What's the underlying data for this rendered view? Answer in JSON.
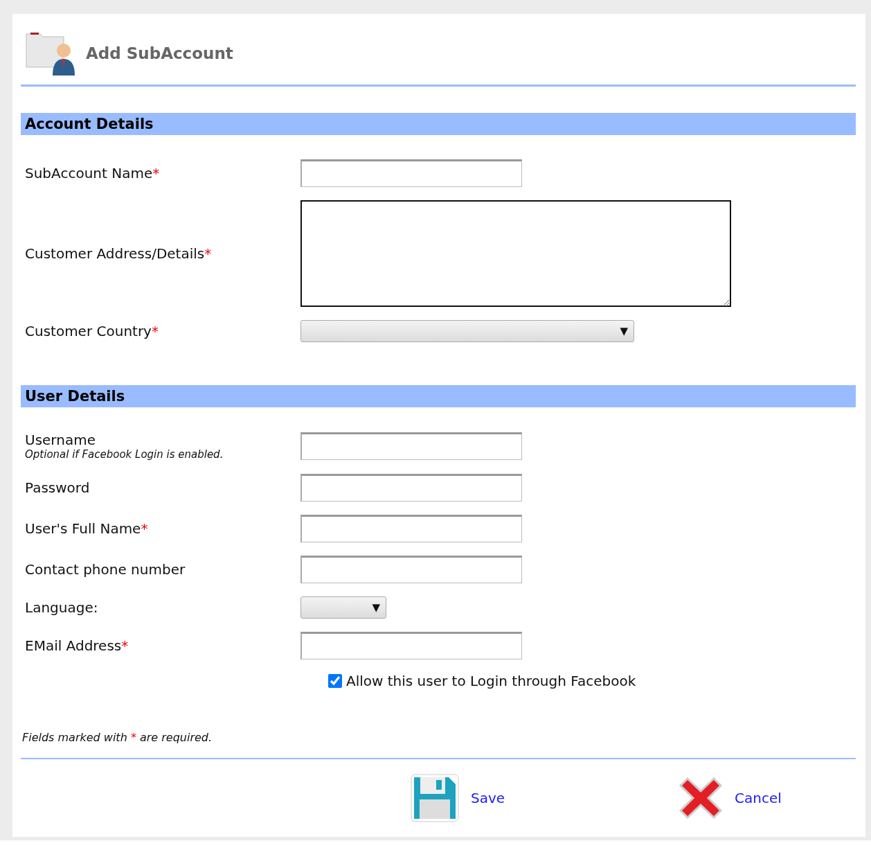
{
  "header": {
    "title": "Add SubAccount"
  },
  "sections": [
    {
      "title": "Account Details",
      "fields": [
        {
          "kind": "text",
          "label": "SubAccount Name",
          "mark": "*"
        },
        {
          "kind": "textarea",
          "label": "Customer Address/Details",
          "mark": "*"
        },
        {
          "kind": "select-wide",
          "label": "Customer Country",
          "mark": "*",
          "arrow": "▼"
        }
      ]
    },
    {
      "title": "User Details",
      "fields": [
        {
          "kind": "text",
          "label": "Username",
          "hint": "Optional if Facebook Login is enabled."
        },
        {
          "kind": "password",
          "label": "Password"
        },
        {
          "kind": "text",
          "label": "User's Full Name",
          "mark": "*"
        },
        {
          "kind": "text",
          "label": "Contact phone number"
        },
        {
          "kind": "select-small",
          "label": "Language:",
          "arrow": "▼"
        },
        {
          "kind": "text",
          "label": "EMail Address",
          "mark": "*"
        },
        {
          "kind": "checkbox",
          "label": "Allow this user to Login through Facebook",
          "checked": true
        }
      ]
    }
  ],
  "note": {
    "before": "Fields marked with",
    "mark": "*",
    "after": "are required."
  },
  "buttons": [
    {
      "kind": "save",
      "label": "Save"
    },
    {
      "kind": "cancel",
      "label": "Cancel"
    }
  ]
}
